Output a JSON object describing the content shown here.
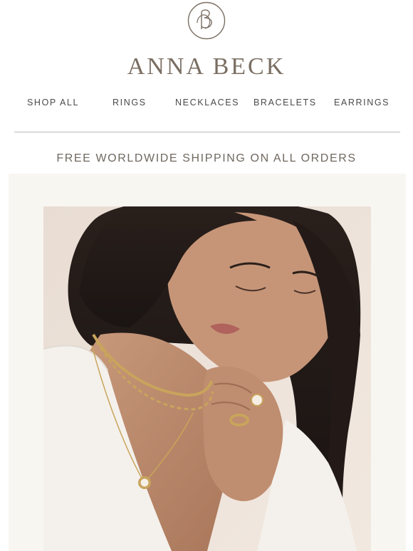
{
  "brand": {
    "name": "ANNA BECK",
    "monogram_icon": "ab-monogram-icon"
  },
  "nav": {
    "items": [
      {
        "label": "SHOP ALL"
      },
      {
        "label": "RINGS"
      },
      {
        "label": "NECKLACES"
      },
      {
        "label": "BRACELETS"
      },
      {
        "label": "EARRINGS"
      }
    ]
  },
  "banner": {
    "shipping_text": "FREE WORLDWIDE SHIPPING ON ALL ORDERS"
  },
  "colors": {
    "brand_text": "#7a6e62",
    "hero_background": "#f8f6f1",
    "gold_accent": "#c9a45c"
  }
}
